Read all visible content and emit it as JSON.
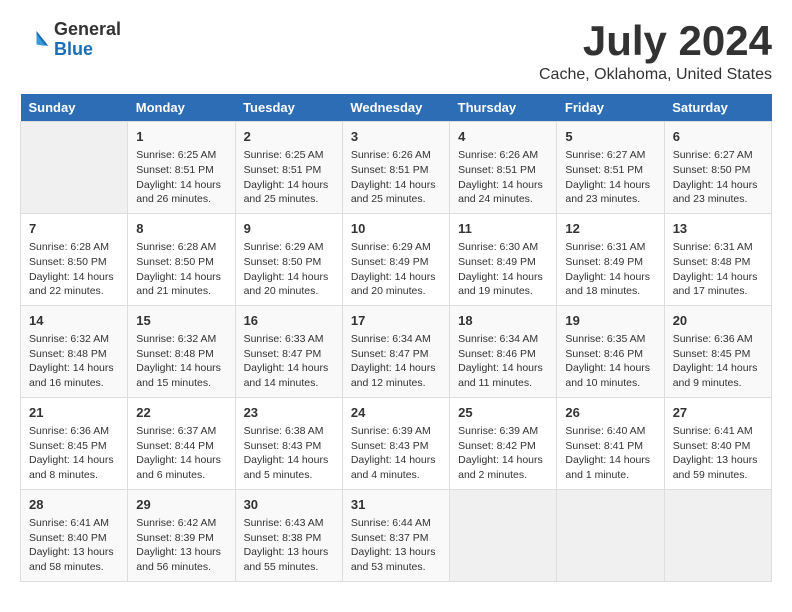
{
  "logo": {
    "general": "General",
    "blue": "Blue"
  },
  "title": "July 2024",
  "location": "Cache, Oklahoma, United States",
  "days_of_week": [
    "Sunday",
    "Monday",
    "Tuesday",
    "Wednesday",
    "Thursday",
    "Friday",
    "Saturday"
  ],
  "weeks": [
    [
      {
        "day": "",
        "info": ""
      },
      {
        "day": "1",
        "info": "Sunrise: 6:25 AM\nSunset: 8:51 PM\nDaylight: 14 hours\nand 26 minutes."
      },
      {
        "day": "2",
        "info": "Sunrise: 6:25 AM\nSunset: 8:51 PM\nDaylight: 14 hours\nand 25 minutes."
      },
      {
        "day": "3",
        "info": "Sunrise: 6:26 AM\nSunset: 8:51 PM\nDaylight: 14 hours\nand 25 minutes."
      },
      {
        "day": "4",
        "info": "Sunrise: 6:26 AM\nSunset: 8:51 PM\nDaylight: 14 hours\nand 24 minutes."
      },
      {
        "day": "5",
        "info": "Sunrise: 6:27 AM\nSunset: 8:51 PM\nDaylight: 14 hours\nand 23 minutes."
      },
      {
        "day": "6",
        "info": "Sunrise: 6:27 AM\nSunset: 8:50 PM\nDaylight: 14 hours\nand 23 minutes."
      }
    ],
    [
      {
        "day": "7",
        "info": "Sunrise: 6:28 AM\nSunset: 8:50 PM\nDaylight: 14 hours\nand 22 minutes."
      },
      {
        "day": "8",
        "info": "Sunrise: 6:28 AM\nSunset: 8:50 PM\nDaylight: 14 hours\nand 21 minutes."
      },
      {
        "day": "9",
        "info": "Sunrise: 6:29 AM\nSunset: 8:50 PM\nDaylight: 14 hours\nand 20 minutes."
      },
      {
        "day": "10",
        "info": "Sunrise: 6:29 AM\nSunset: 8:49 PM\nDaylight: 14 hours\nand 20 minutes."
      },
      {
        "day": "11",
        "info": "Sunrise: 6:30 AM\nSunset: 8:49 PM\nDaylight: 14 hours\nand 19 minutes."
      },
      {
        "day": "12",
        "info": "Sunrise: 6:31 AM\nSunset: 8:49 PM\nDaylight: 14 hours\nand 18 minutes."
      },
      {
        "day": "13",
        "info": "Sunrise: 6:31 AM\nSunset: 8:48 PM\nDaylight: 14 hours\nand 17 minutes."
      }
    ],
    [
      {
        "day": "14",
        "info": "Sunrise: 6:32 AM\nSunset: 8:48 PM\nDaylight: 14 hours\nand 16 minutes."
      },
      {
        "day": "15",
        "info": "Sunrise: 6:32 AM\nSunset: 8:48 PM\nDaylight: 14 hours\nand 15 minutes."
      },
      {
        "day": "16",
        "info": "Sunrise: 6:33 AM\nSunset: 8:47 PM\nDaylight: 14 hours\nand 14 minutes."
      },
      {
        "day": "17",
        "info": "Sunrise: 6:34 AM\nSunset: 8:47 PM\nDaylight: 14 hours\nand 12 minutes."
      },
      {
        "day": "18",
        "info": "Sunrise: 6:34 AM\nSunset: 8:46 PM\nDaylight: 14 hours\nand 11 minutes."
      },
      {
        "day": "19",
        "info": "Sunrise: 6:35 AM\nSunset: 8:46 PM\nDaylight: 14 hours\nand 10 minutes."
      },
      {
        "day": "20",
        "info": "Sunrise: 6:36 AM\nSunset: 8:45 PM\nDaylight: 14 hours\nand 9 minutes."
      }
    ],
    [
      {
        "day": "21",
        "info": "Sunrise: 6:36 AM\nSunset: 8:45 PM\nDaylight: 14 hours\nand 8 minutes."
      },
      {
        "day": "22",
        "info": "Sunrise: 6:37 AM\nSunset: 8:44 PM\nDaylight: 14 hours\nand 6 minutes."
      },
      {
        "day": "23",
        "info": "Sunrise: 6:38 AM\nSunset: 8:43 PM\nDaylight: 14 hours\nand 5 minutes."
      },
      {
        "day": "24",
        "info": "Sunrise: 6:39 AM\nSunset: 8:43 PM\nDaylight: 14 hours\nand 4 minutes."
      },
      {
        "day": "25",
        "info": "Sunrise: 6:39 AM\nSunset: 8:42 PM\nDaylight: 14 hours\nand 2 minutes."
      },
      {
        "day": "26",
        "info": "Sunrise: 6:40 AM\nSunset: 8:41 PM\nDaylight: 14 hours\nand 1 minute."
      },
      {
        "day": "27",
        "info": "Sunrise: 6:41 AM\nSunset: 8:40 PM\nDaylight: 13 hours\nand 59 minutes."
      }
    ],
    [
      {
        "day": "28",
        "info": "Sunrise: 6:41 AM\nSunset: 8:40 PM\nDaylight: 13 hours\nand 58 minutes."
      },
      {
        "day": "29",
        "info": "Sunrise: 6:42 AM\nSunset: 8:39 PM\nDaylight: 13 hours\nand 56 minutes."
      },
      {
        "day": "30",
        "info": "Sunrise: 6:43 AM\nSunset: 8:38 PM\nDaylight: 13 hours\nand 55 minutes."
      },
      {
        "day": "31",
        "info": "Sunrise: 6:44 AM\nSunset: 8:37 PM\nDaylight: 13 hours\nand 53 minutes."
      },
      {
        "day": "",
        "info": ""
      },
      {
        "day": "",
        "info": ""
      },
      {
        "day": "",
        "info": ""
      }
    ]
  ]
}
